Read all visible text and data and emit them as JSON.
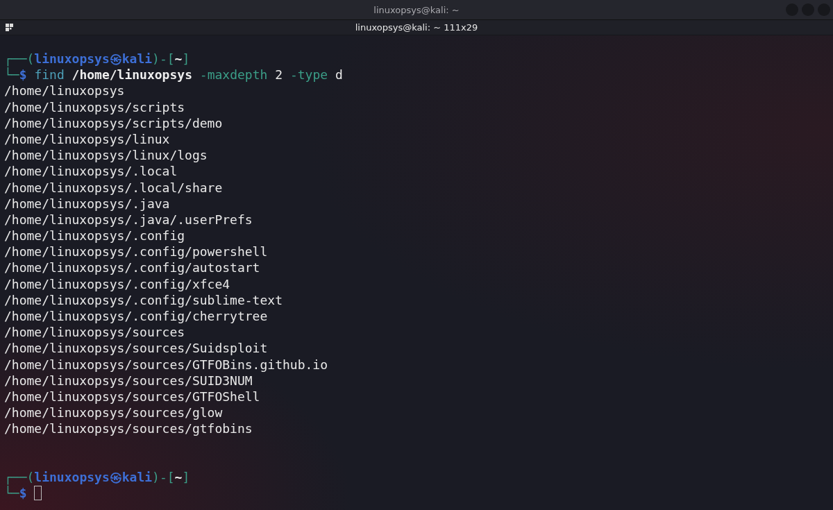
{
  "window": {
    "title": "linuxopsys@kali: ~"
  },
  "tab": {
    "title": "linuxopsys@kali: ~ 111x29"
  },
  "terminal": {
    "entries": [
      {
        "prompt": {
          "corner_top": "┌──(",
          "user": "linuxopsys",
          "symbol": "㉿",
          "host": "kali",
          "separator": ")-[",
          "cwd": "~",
          "close": "]",
          "corner_bottom": "└─",
          "sign": "$"
        },
        "command": [
          {
            "kind": "program",
            "text": "find"
          },
          {
            "kind": "path",
            "text": "/home/linuxopsys"
          },
          {
            "kind": "option",
            "text": "-maxdepth"
          },
          {
            "kind": "value",
            "text": "2"
          },
          {
            "kind": "option",
            "text": "-type"
          },
          {
            "kind": "value",
            "text": "d"
          }
        ],
        "output": [
          "/home/linuxopsys",
          "/home/linuxopsys/scripts",
          "/home/linuxopsys/scripts/demo",
          "/home/linuxopsys/linux",
          "/home/linuxopsys/linux/logs",
          "/home/linuxopsys/.local",
          "/home/linuxopsys/.local/share",
          "/home/linuxopsys/.java",
          "/home/linuxopsys/.java/.userPrefs",
          "/home/linuxopsys/.config",
          "/home/linuxopsys/.config/powershell",
          "/home/linuxopsys/.config/autostart",
          "/home/linuxopsys/.config/xfce4",
          "/home/linuxopsys/.config/sublime-text",
          "/home/linuxopsys/.config/cherrytree",
          "/home/linuxopsys/sources",
          "/home/linuxopsys/sources/Suidsploit",
          "/home/linuxopsys/sources/GTFOBins.github.io",
          "/home/linuxopsys/sources/SUID3NUM",
          "/home/linuxopsys/sources/GTFOShell",
          "/home/linuxopsys/sources/glow",
          "/home/linuxopsys/sources/gtfobins"
        ],
        "cursor": false
      },
      {
        "prompt": {
          "corner_top": "┌──(",
          "user": "linuxopsys",
          "symbol": "㉿",
          "host": "kali",
          "separator": ")-[",
          "cwd": "~",
          "close": "]",
          "corner_bottom": "└─",
          "sign": "$"
        },
        "cursor": true
      }
    ]
  }
}
